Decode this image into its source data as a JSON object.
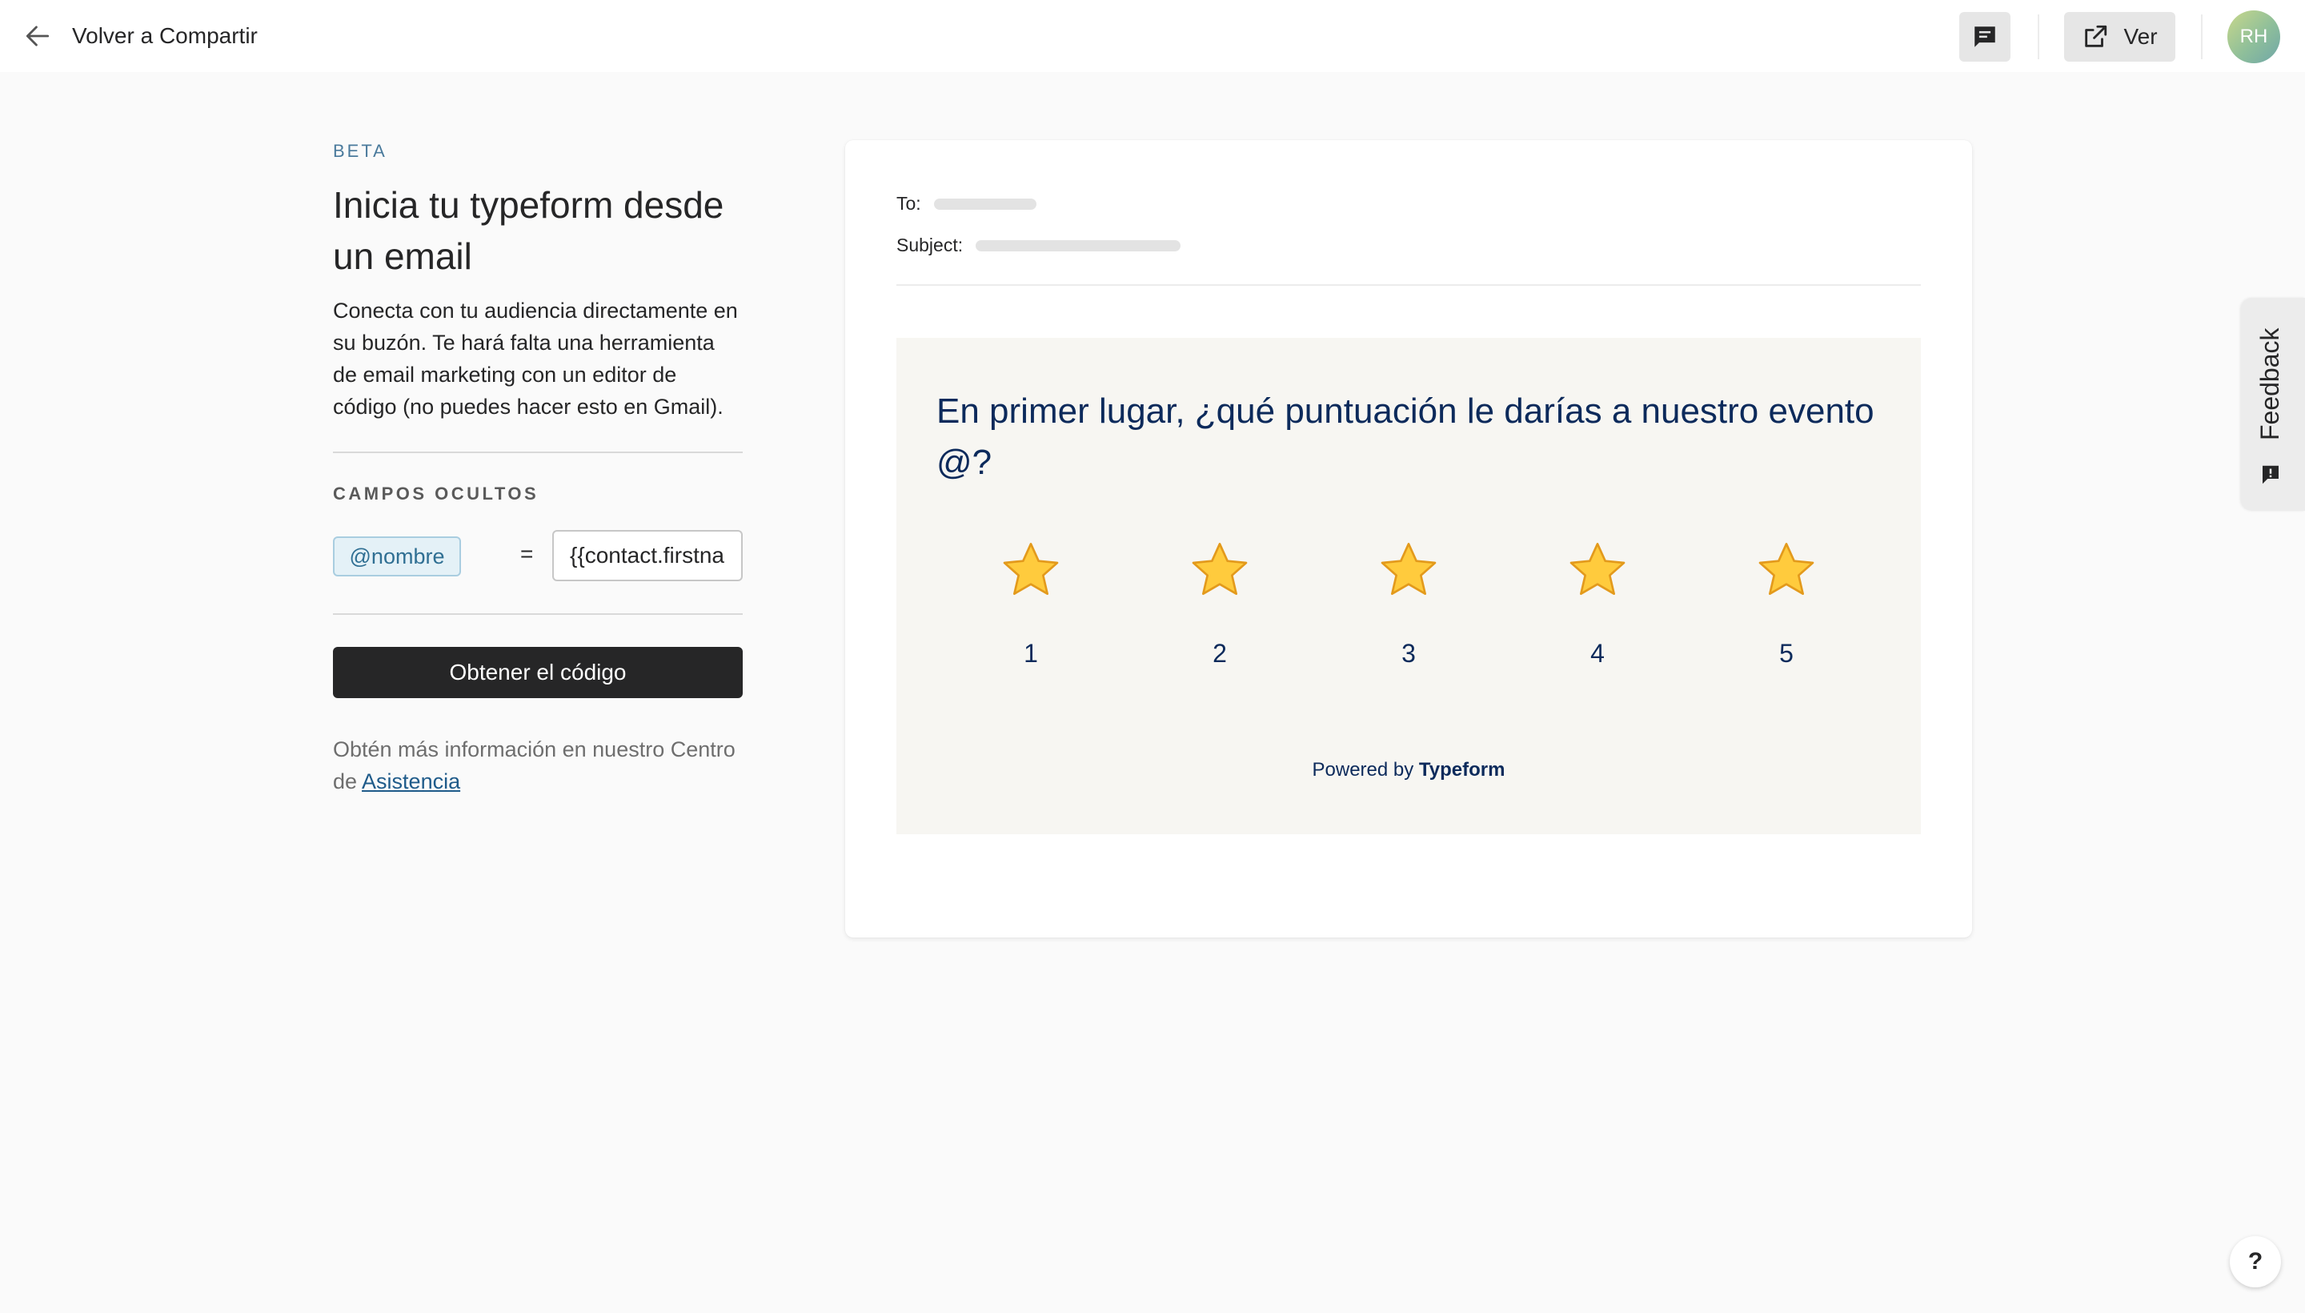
{
  "topbar": {
    "back_label": "Volver a Compartir",
    "view_label": "Ver",
    "avatar_initials": "RH"
  },
  "left": {
    "beta": "BETA",
    "title": "Inicia tu typeform desde un email",
    "description": "Conecta con tu audiencia directamente en su buzón. Te hará falta una herramienta de email marketing con un editor de código (no puedes hacer esto en Gmail).",
    "hidden_fields_title": "CAMPOS OCULTOS",
    "hidden_field": {
      "name": "@nombre",
      "equals": "=",
      "value": "{{contact.firstname}}"
    },
    "get_code_label": "Obtener el código",
    "help_text_prefix": "Obtén más información en nuestro Centro de ",
    "help_link": "Asistencia"
  },
  "preview": {
    "to_label": "To:",
    "subject_label": "Subject:",
    "question": "En primer lugar, ¿qué puntuación le darías a nuestro evento @?",
    "ratings": [
      {
        "label": "1"
      },
      {
        "label": "2"
      },
      {
        "label": "3"
      },
      {
        "label": "4"
      },
      {
        "label": "5"
      }
    ],
    "powered_prefix": "Powered by ",
    "powered_brand": "Typeform"
  },
  "feedback_label": "Feedback",
  "help_button_label": "?",
  "colors": {
    "accent_dark": "#262627",
    "question_text": "#0c2a5b",
    "chip_bg": "#e4f1f7",
    "chip_text": "#2f6f93",
    "star_fill": "#ffcb3d"
  },
  "icons": {
    "back": "arrow-left-icon",
    "chat": "chat-icon",
    "view": "external-link-icon",
    "star": "star-icon",
    "feedback": "feedback-icon"
  }
}
